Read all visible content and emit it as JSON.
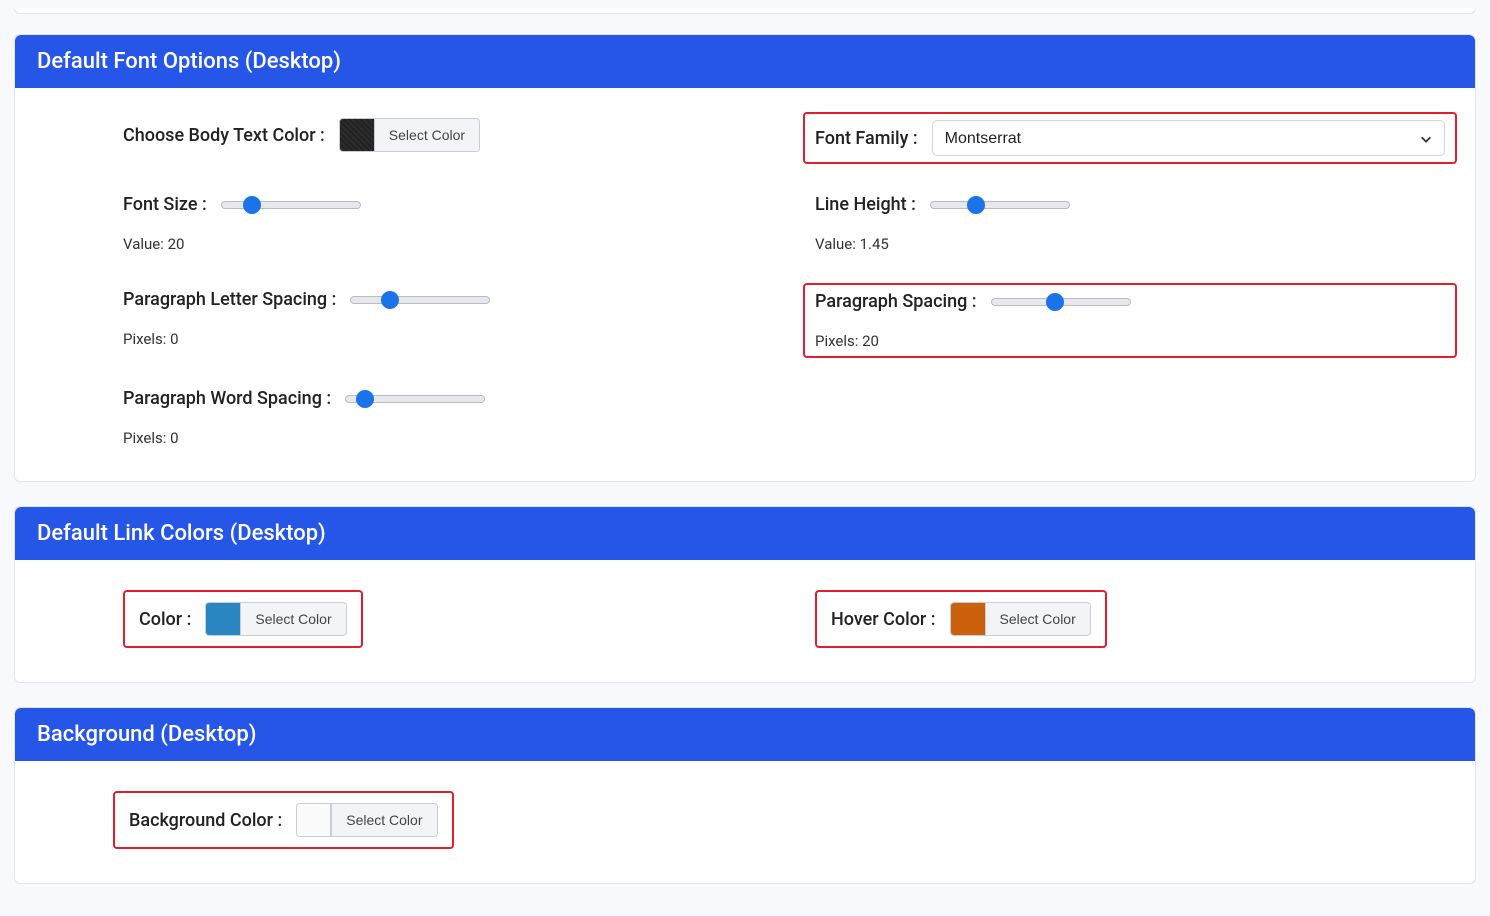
{
  "panels": {
    "font": {
      "title": "Default Font Options (Desktop)",
      "body_color": {
        "label": "Choose Body Text Color :",
        "button": "Select Color"
      },
      "font_family": {
        "label": "Font Family :",
        "value": "Montserrat"
      },
      "font_size": {
        "label": "Font Size :",
        "value_prefix": "Value: ",
        "value": "20"
      },
      "line_height": {
        "label": "Line Height :",
        "value_prefix": "Value: ",
        "value": "1.45"
      },
      "letter_spacing": {
        "label": "Paragraph Letter Spacing :",
        "value_prefix": "Pixels: ",
        "value": "0"
      },
      "paragraph_spacing": {
        "label": "Paragraph Spacing :",
        "value_prefix": "Pixels: ",
        "value": "20"
      },
      "word_spacing": {
        "label": "Paragraph Word Spacing :",
        "value_prefix": "Pixels: ",
        "value": "0"
      }
    },
    "links": {
      "title": "Default Link Colors (Desktop)",
      "color": {
        "label": "Color :",
        "button": "Select Color"
      },
      "hover": {
        "label": "Hover Color :",
        "button": "Select Color"
      }
    },
    "background": {
      "title": "Background (Desktop)",
      "bg_color": {
        "label": "Background Color :",
        "button": "Select Color"
      }
    }
  },
  "colors": {
    "body_text": "#282828",
    "link": "#2a86c1",
    "hover": "#cb610d",
    "background": "#fafafa"
  }
}
